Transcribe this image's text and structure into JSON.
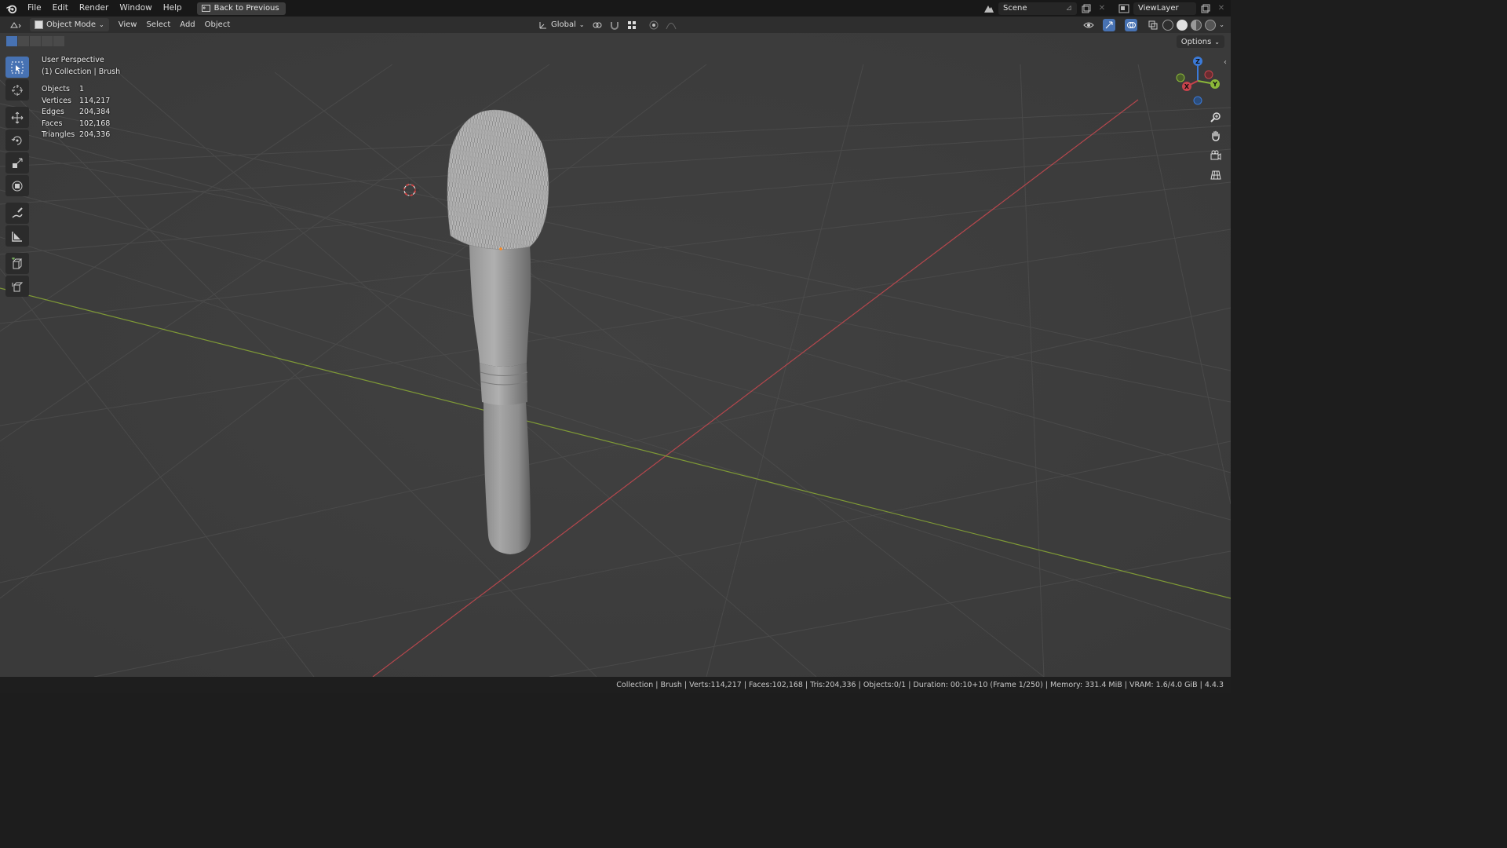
{
  "menu": {
    "items": [
      "File",
      "Edit",
      "Render",
      "Window",
      "Help"
    ],
    "back_label": "Back to Previous"
  },
  "top_right": {
    "scene_name": "Scene",
    "view_layer": "ViewLayer"
  },
  "header": {
    "mode": "Object Mode",
    "menus": [
      "View",
      "Select",
      "Add",
      "Object"
    ],
    "transform_orientation": "Global"
  },
  "viewport": {
    "options_label": "Options",
    "overlay_title": "User Perspective",
    "overlay_subtitle": "(1) Collection | Brush",
    "stats": [
      {
        "label": "Objects",
        "value": "1"
      },
      {
        "label": "Vertices",
        "value": "114,217"
      },
      {
        "label": "Edges",
        "value": "204,384"
      },
      {
        "label": "Faces",
        "value": "102,168"
      },
      {
        "label": "Triangles",
        "value": "204,336"
      }
    ],
    "gizmo": {
      "x": "X",
      "y": "Y",
      "z": "Z"
    }
  },
  "toolbar_icons": [
    "select-box-icon",
    "cursor-icon",
    "move-icon",
    "rotate-icon",
    "scale-icon",
    "transform-icon",
    "annotate-icon",
    "measure-icon",
    "add-cube-icon",
    "add-object-icon"
  ],
  "colors": {
    "x_axis": "#c8424b",
    "y_axis": "#8bb839",
    "z_axis": "#3b7ad8",
    "active_tool": "#4772b3"
  },
  "status": {
    "text": "Collection | Brush | Verts:114,217 | Faces:102,168 | Tris:204,336 | Objects:0/1 | Duration: 00:10+10 (Frame 1/250) | Memory: 331.4 MiB | VRAM: 1.6/4.0 GiB | 4.4.3"
  }
}
